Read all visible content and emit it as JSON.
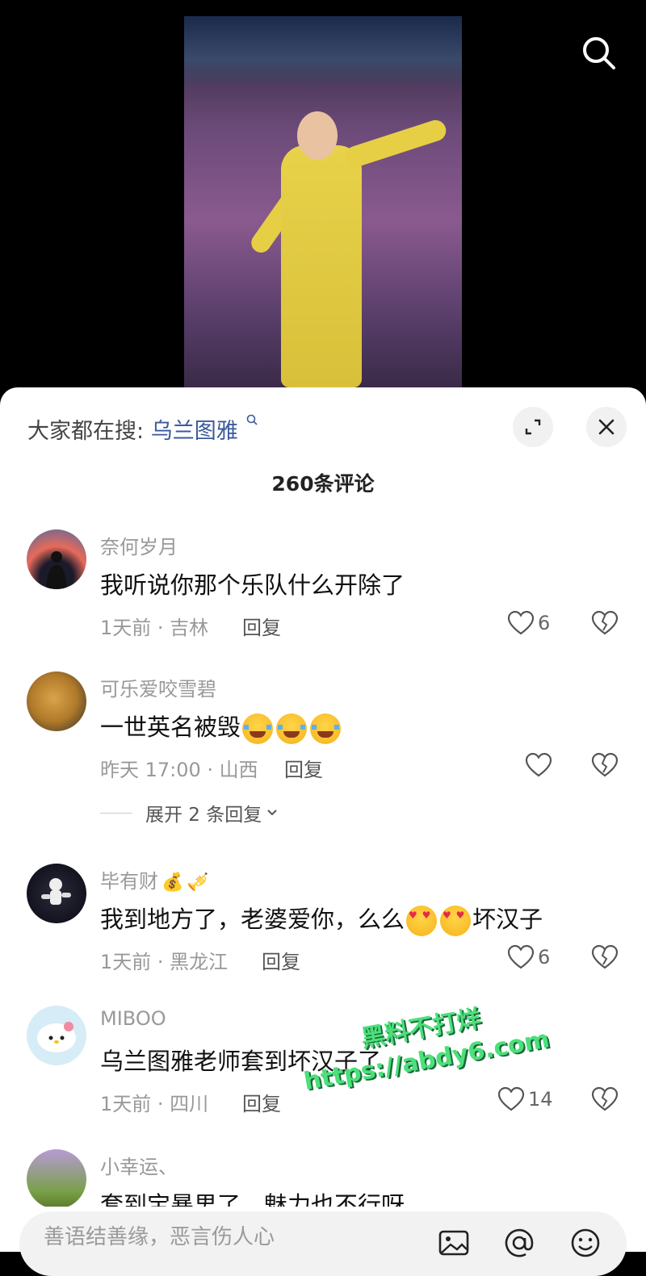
{
  "header": {
    "hot_search_prefix": "大家都在搜:",
    "hot_search_term": "乌兰图雅",
    "comment_count": "260条评论"
  },
  "comments": [
    {
      "username": "奈何岁月",
      "content": "我听说你那个乐队什么开除了",
      "meta": "1天前 · 吉林",
      "reply": "回复",
      "likes": "6"
    },
    {
      "username": "可乐爱咬雪碧",
      "content": "一世英名被毁",
      "meta": "昨天 17:00 · 山西",
      "reply": "回复",
      "likes": "",
      "expand": "展开 2 条回复"
    },
    {
      "username": "毕有财",
      "content_a": "我到地方了，老婆爱你，么么",
      "content_b": "坏汉子",
      "meta": "1天前 · 黑龙江",
      "reply": "回复",
      "likes": "6"
    },
    {
      "username": "MIBOO",
      "content": "乌兰图雅老师套到坏汉子了",
      "meta": "1天前 · 四川",
      "reply": "回复",
      "likes": "14"
    },
    {
      "username": "小幸运、",
      "content": "套到宝暴男了，魅力也不行呀"
    }
  ],
  "watermark": {
    "line1": "黑料不打烊",
    "line2": "https://abdy6.com"
  },
  "input": {
    "placeholder": "善语结善缘，恶言伤人心"
  },
  "icons": [
    "search-icon",
    "expand-icon",
    "close-icon",
    "heart-icon",
    "broken-heart-icon",
    "image-icon",
    "at-icon",
    "emoji-icon",
    "chevron-down-icon"
  ],
  "colors": {
    "hot_term": "#3a5a9a",
    "meta": "#999999",
    "watermark": "#4be07a"
  }
}
